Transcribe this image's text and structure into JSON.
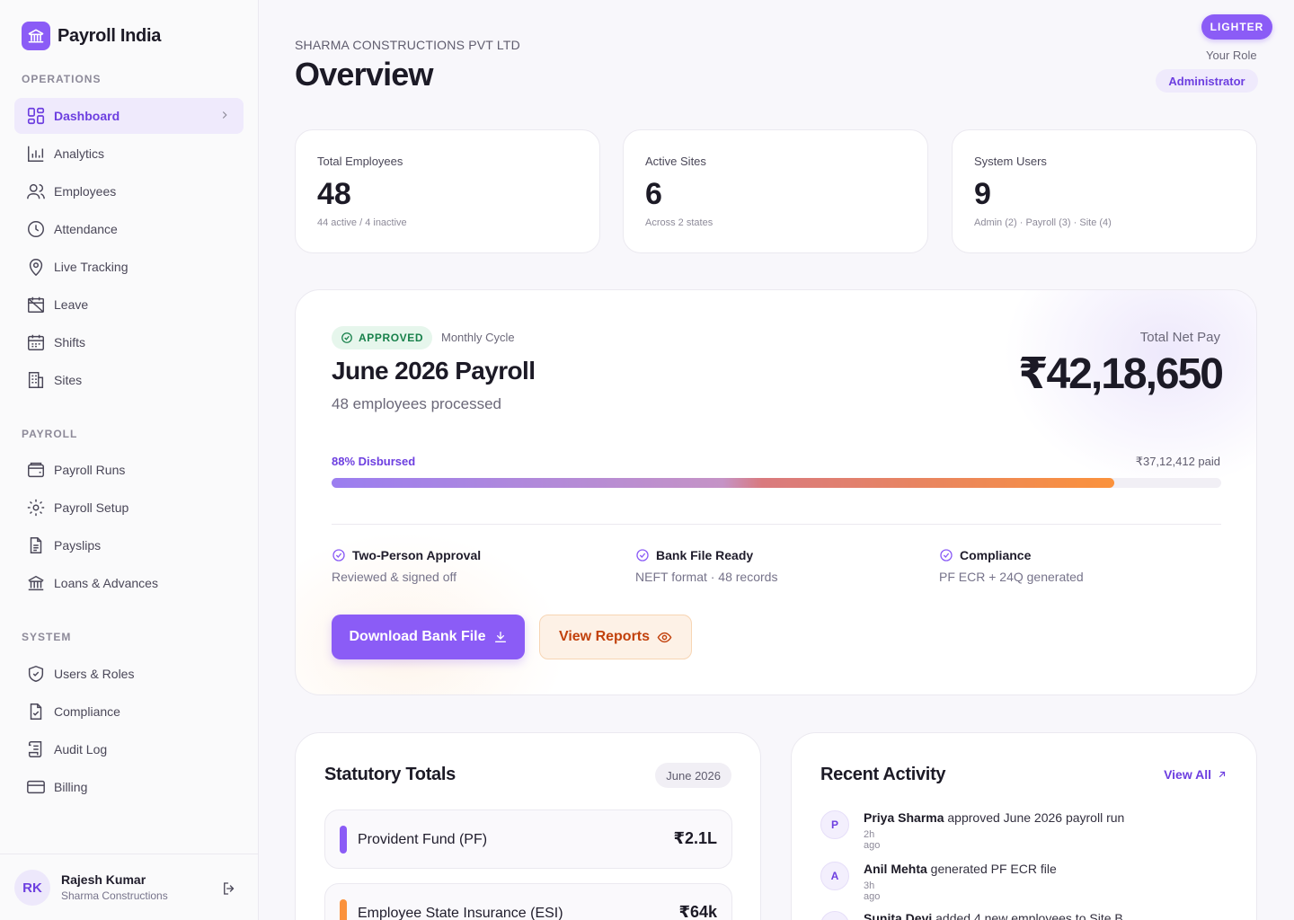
{
  "app": {
    "name": "Payroll India"
  },
  "sidebar": {
    "sections": {
      "operations": "OPERATIONS",
      "payroll": "PAYROLL",
      "system": "SYSTEM"
    },
    "items": [
      {
        "label": "Dashboard",
        "icon": "grid-icon",
        "active": true
      },
      {
        "label": "Analytics",
        "icon": "bar-chart-icon"
      },
      {
        "label": "Employees",
        "icon": "users-icon"
      },
      {
        "label": "Attendance",
        "icon": "clock-icon"
      },
      {
        "label": "Live Tracking",
        "icon": "map-pin-icon"
      },
      {
        "label": "Leave",
        "icon": "calendar-off-icon"
      },
      {
        "label": "Shifts",
        "icon": "calendar-icon"
      },
      {
        "label": "Sites",
        "icon": "building-icon"
      },
      {
        "label": "Payroll Runs",
        "icon": "wallet-icon"
      },
      {
        "label": "Payroll Setup",
        "icon": "gear-icon"
      },
      {
        "label": "Payslips",
        "icon": "file-text-icon"
      },
      {
        "label": "Loans & Advances",
        "icon": "bank-icon"
      },
      {
        "label": "Users & Roles",
        "icon": "shield-icon"
      },
      {
        "label": "Compliance",
        "icon": "file-check-icon"
      },
      {
        "label": "Audit Log",
        "icon": "scroll-icon"
      },
      {
        "label": "Billing",
        "icon": "credit-card-icon"
      }
    ],
    "user": {
      "initials": "RK",
      "name": "Rajesh Kumar",
      "org": "Sharma Constructions"
    }
  },
  "header": {
    "company": "SHARMA CONSTRUCTIONS PVT LTD",
    "title": "Overview",
    "theme_button": "LIGHTER",
    "role_label": "Your Role",
    "role": "Administrator"
  },
  "stats": [
    {
      "label": "Total Employees",
      "value": "48",
      "sub": "44 active / 4 inactive"
    },
    {
      "label": "Active Sites",
      "value": "6",
      "sub": "Across 2 states"
    },
    {
      "label": "System Users",
      "value": "9",
      "sub": "Admin (2) · Payroll (3) · Site (4)"
    }
  ],
  "payroll": {
    "status": "APPROVED",
    "cycle": "Monthly Cycle",
    "title": "June 2026 Payroll",
    "subtitle": "48 employees processed",
    "net_pay_label": "Total Net Pay",
    "net_pay": "₹42,18,650",
    "progress_label": "88% Disbursed",
    "progress_fraction": 0.88,
    "paid": "₹37,12,412 paid",
    "checks": [
      {
        "title": "Two-Person Approval",
        "desc": "Reviewed & signed off"
      },
      {
        "title": "Bank File Ready",
        "desc": "NEFT format · 48 records"
      },
      {
        "title": "Compliance",
        "desc": "PF ECR + 24Q generated"
      }
    ],
    "primary_button": "Download Bank File",
    "secondary_button": "View Reports"
  },
  "statutory": {
    "title": "Statutory Totals",
    "month": "June 2026",
    "rows": [
      {
        "label": "Provident Fund (PF)",
        "value": "₹2.1L",
        "color": "#8b5cf6"
      },
      {
        "label": "Employee State Insurance (ESI)",
        "value": "₹64k",
        "color": "#fb923c"
      }
    ]
  },
  "activity": {
    "title": "Recent Activity",
    "view_all": "View All",
    "items": [
      {
        "initial": "P",
        "name": "Priya Sharma",
        "text": " approved June 2026 payroll run",
        "time": "2h ago"
      },
      {
        "initial": "A",
        "name": "Anil Mehta",
        "text": " generated PF ECR file",
        "time": "3h ago"
      },
      {
        "initial": "S",
        "name": "Sunita Devi",
        "text": " added 4 new employees to Site B",
        "time": ""
      }
    ]
  },
  "colors": {
    "accent": "#8b5cf6",
    "success": "#17804a",
    "warning": "#fb923c"
  }
}
